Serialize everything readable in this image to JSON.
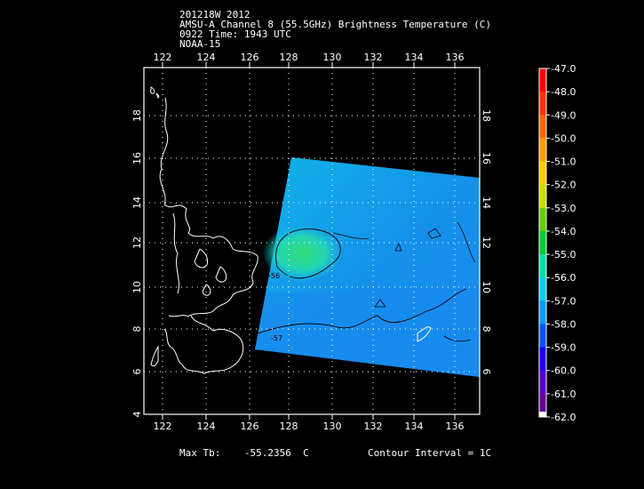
{
  "header": {
    "line1": "201218W 2012",
    "line2": "AMSU-A Channel 8 (55.5GHz) Brightness Temperature (C)",
    "line3": "0922 Time: 1943 UTC",
    "line4": "NOAA-15"
  },
  "map": {
    "lon_ticks": [
      "122",
      "124",
      "126",
      "128",
      "130",
      "132",
      "134",
      "136"
    ],
    "lat_ticks": [
      "18",
      "16",
      "14",
      "12",
      "10",
      "8",
      "6",
      "4"
    ],
    "lon_range": [
      121,
      137.2
    ],
    "lat_range": [
      4,
      19.5
    ],
    "contour_labels": [
      "-56",
      "-57"
    ]
  },
  "colorbar": {
    "labels": [
      "-47.0",
      "-48.0",
      "-49.0",
      "-50.0",
      "-51.0",
      "-52.0",
      "-53.0",
      "-54.0",
      "-55.0",
      "-56.0",
      "-57.0",
      "-58.0",
      "-59.0",
      "-60.0",
      "-61.0",
      "-62.0"
    ],
    "colors": [
      "#ff0000",
      "#ff3300",
      "#ff6600",
      "#ff9900",
      "#ffcc00",
      "#ccdd00",
      "#66cc00",
      "#00cc33",
      "#00ddaa",
      "#00ccee",
      "#0099ff",
      "#0055ff",
      "#2200ee",
      "#5500cc",
      "#660099",
      "#ffffff"
    ]
  },
  "footer": {
    "max_tb": "Max Tb:    -55.2356  C",
    "contour_interval": "Contour Interval = 1C"
  }
}
